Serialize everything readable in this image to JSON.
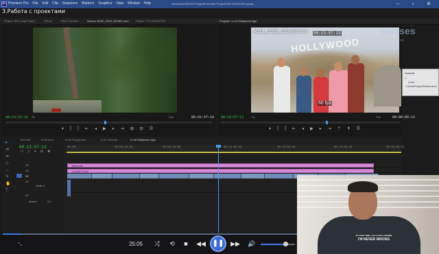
{
  "window": {
    "logo": "Pr",
    "menu": [
      "Premiere Pro",
      "File",
      "Edit",
      "Clip",
      "Sequence",
      "Markers",
      "Graphics",
      "View",
      "Window",
      "Help"
    ],
    "doc_title": "/Volumes/CREATE Project/Premiere Project/TSU SOURCES.prproj"
  },
  "caption": "3.Работа с проектами",
  "panel_tabs": {
    "project": "Project: WS Long Project",
    "effects": "Effects",
    "effect_controls": "Effect Controls",
    "source": "Source: A022_C023_0223A1.mov",
    "project2": "Project: TSU SOURCES",
    "program": "Program: b-roll Hollywood sign"
  },
  "source_monitor": {
    "timecode_left": "00:13:21:16",
    "fit": "Fit",
    "zoom": "Full",
    "timecode_right": "00:01:47:18"
  },
  "program_monitor": {
    "clip_name": "A019_C022_022499.mov",
    "overlay_timecode": "00:13:57:13",
    "fps": "60 fps",
    "sign_text": "HOLLYWOOD",
    "timecode_left": "00:13:57:13",
    "fit": "Fit",
    "zoom": "Full",
    "timecode_right": "00:00:05:12"
  },
  "watermark": {
    "brand": "classes",
    "url": "classes.ru"
  },
  "console_panel": {
    "title": "Console",
    "lines": [
      "> ",
      "cross",
      "CreateProjectReferences"
    ]
  },
  "timeline": {
    "tabs": [
      "text edit",
      "b-roll pool",
      "b-roll Playground",
      "b-roll Steering",
      "b-roll Hollywood sign"
    ],
    "timecode": "00:13:57:13",
    "ruler": [
      "00:00",
      "00:04:59:16",
      "00:09:59:09",
      "00:14:59:02",
      "00:19:58:19",
      "00:24:58:12",
      "00:29:58:04"
    ],
    "tracks": [
      "V3",
      "V2",
      "V1",
      "A1",
      "A2",
      "Master"
    ],
    "track_label_a1": "Audio 1",
    "master_value": "0.0",
    "clip_v3": "timecode",
    "clip_v2": "Lumetri Color",
    "selected_track": "V1"
  },
  "player": {
    "time": "25:05",
    "progress_fraction": 0.065,
    "volume_fraction": 0.72
  },
  "webcam": {
    "shirt_line1": "TO SAVE TIME, LET'S JUST ASSUME",
    "shirt_line2": "I'M NEVER WRONG"
  },
  "colors": {
    "accent_blue": "#3c7ee8",
    "timecode_green": "#3fd04a",
    "clip_pink": "#d58ad8",
    "clip_blue": "#6d8bb6"
  }
}
